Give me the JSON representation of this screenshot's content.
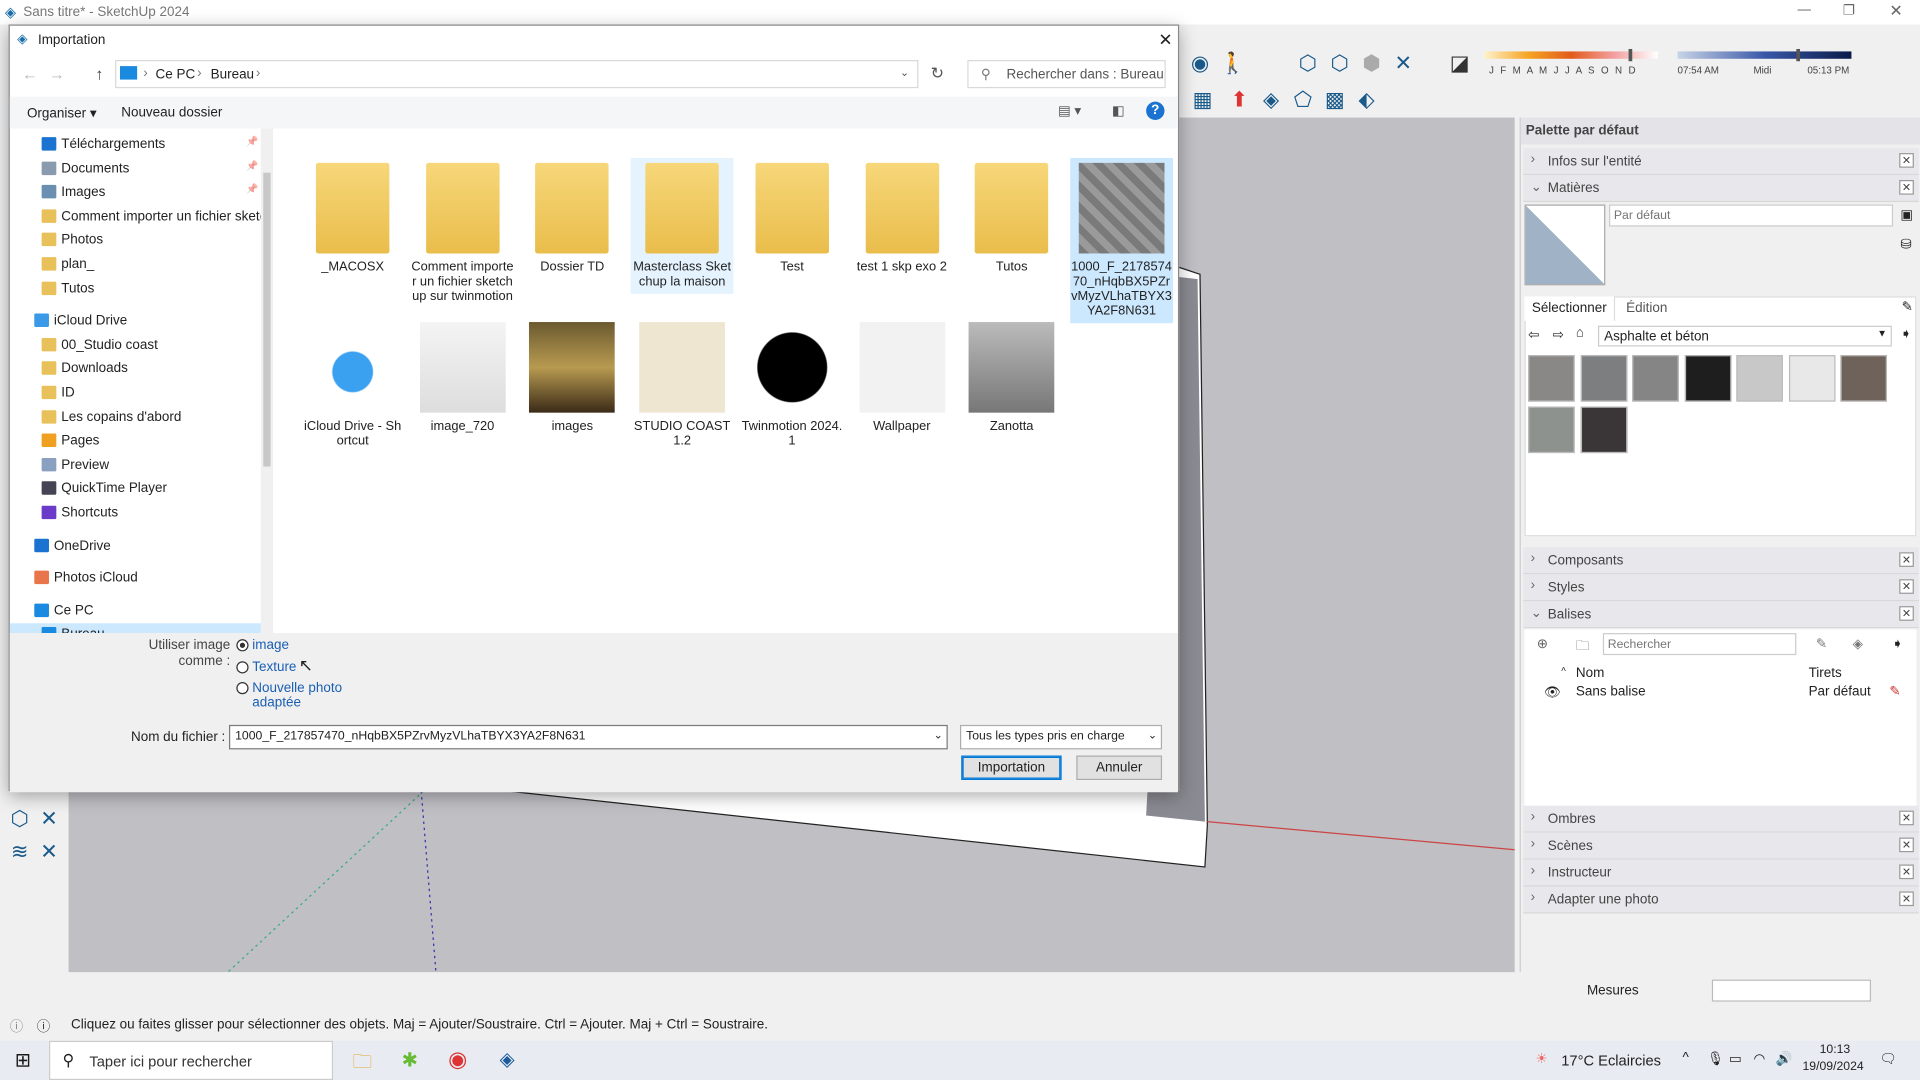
{
  "app": {
    "title": "Sans titre* - SketchUp 2024"
  },
  "toolbar": {
    "months": "J F M A M J J A S O N D",
    "time_start": "07:54 AM",
    "time_mid": "Midi",
    "time_end": "05:13 PM",
    "shadow_time_fraction": 0.7,
    "shadow_date_fraction": 0.85
  },
  "dialog": {
    "title": "Importation",
    "breadcrumb": [
      "Ce PC",
      "Bureau"
    ],
    "search_placeholder": "Rechercher dans : Bureau",
    "organize": "Organiser",
    "new_folder": "Nouveau dossier",
    "nav": [
      {
        "label": "Téléchargements",
        "icon": "download-icon",
        "pinned": true
      },
      {
        "label": "Documents",
        "icon": "documents-icon",
        "pinned": true
      },
      {
        "label": "Images",
        "icon": "images-icon",
        "pinned": true
      },
      {
        "label": "Comment importer un fichier sketchup",
        "icon": "folder-icon"
      },
      {
        "label": "Photos",
        "icon": "folder-icon"
      },
      {
        "label": "plan_",
        "icon": "folder-icon"
      },
      {
        "label": "Tutos",
        "icon": "folder-icon"
      },
      {
        "label": "iCloud Drive",
        "icon": "icloud-icon",
        "root": true
      },
      {
        "label": "00_Studio coast",
        "icon": "folder-icon"
      },
      {
        "label": "Downloads",
        "icon": "folder-icon"
      },
      {
        "label": "ID",
        "icon": "folder-icon"
      },
      {
        "label": "Les copains d'abord",
        "icon": "folder-icon"
      },
      {
        "label": "Pages",
        "icon": "pages-icon"
      },
      {
        "label": "Preview",
        "icon": "preview-icon"
      },
      {
        "label": "QuickTime Player",
        "icon": "quicktime-icon"
      },
      {
        "label": "Shortcuts",
        "icon": "shortcuts-icon"
      },
      {
        "label": "OneDrive",
        "icon": "onedrive-icon",
        "root": true
      },
      {
        "label": "Photos iCloud",
        "icon": "photos-icon",
        "root": true
      },
      {
        "label": "Ce PC",
        "icon": "pc-icon",
        "root": true
      },
      {
        "label": "Bureau",
        "icon": "desktop-icon",
        "selected": true
      }
    ],
    "files": [
      {
        "name": "_MACOSX",
        "kind": "folder"
      },
      {
        "name": "Comment importer un fichier sketchup sur twinmotion",
        "kind": "folder"
      },
      {
        "name": "Dossier TD",
        "kind": "folder"
      },
      {
        "name": "Masterclass Sketchup la maison",
        "kind": "folder",
        "hover": true
      },
      {
        "name": "Test",
        "kind": "folder"
      },
      {
        "name": "test 1 skp exo 2",
        "kind": "folder"
      },
      {
        "name": "Tutos",
        "kind": "folder"
      },
      {
        "name": "1000_F_217857470_nHqbBX5PZrvMyzVLhaTBYX3YA2F8N631",
        "kind": "image",
        "selected": true
      },
      {
        "name": "iCloud Drive - Shortcut",
        "kind": "shortcut"
      },
      {
        "name": "image_720",
        "kind": "image"
      },
      {
        "name": "images",
        "kind": "image"
      },
      {
        "name": "STUDIO COAST 1.2",
        "kind": "image"
      },
      {
        "name": "Twinmotion 2024.1",
        "kind": "shortcut"
      },
      {
        "name": "Wallpaper",
        "kind": "image"
      },
      {
        "name": "Zanotta",
        "kind": "image"
      }
    ],
    "use_as_label": "Utiliser image comme :",
    "options": [
      {
        "label": "image",
        "checked": true
      },
      {
        "label": "Texture",
        "checked": false
      },
      {
        "label": "Nouvelle photo adaptée",
        "checked": false
      }
    ],
    "filename_label": "Nom du fichier :",
    "filename": "1000_F_217857470_nHqbBX5PZrvMyzVLhaTBYX3YA2F8N631",
    "filetype": "Tous les types pris en charge",
    "import_btn": "Importation",
    "cancel_btn": "Annuler"
  },
  "tray": {
    "title": "Palette par défaut",
    "entity_info": "Infos sur l'entité",
    "materials": "Matières",
    "material_name_placeholder": "Par défaut",
    "tab_select": "Sélectionner",
    "tab_edit": "Édition",
    "library": "Asphalte et béton",
    "swatches": [
      "#8a8886",
      "#7c7e80",
      "#858585",
      "#1e1e1e",
      "#c8c8c8",
      "#e8e8e8",
      "#6e625a",
      "#8e928e",
      "#3a3638"
    ],
    "components": "Composants",
    "styles": "Styles",
    "tags": "Balises",
    "tags_search_placeholder": "Rechercher",
    "tags_col_name": "Nom",
    "tags_col_dash": "Tirets",
    "tag_row": {
      "name": "Sans balise",
      "dash": "Par défaut"
    },
    "shadows": "Ombres",
    "scenes": "Scènes",
    "instructor": "Instructeur",
    "match_photo": "Adapter une photo"
  },
  "status": {
    "hint": "Cliquez ou faites glisser pour sélectionner des objets. Maj = Ajouter/Soustraire. Ctrl = Ajouter. Maj + Ctrl = Soustraire.",
    "measures_label": "Mesures"
  },
  "taskbar": {
    "search_placeholder": "Taper ici pour rechercher",
    "weather": "17°C  Eclaircies",
    "time": "10:13",
    "date": "19/09/2024"
  }
}
